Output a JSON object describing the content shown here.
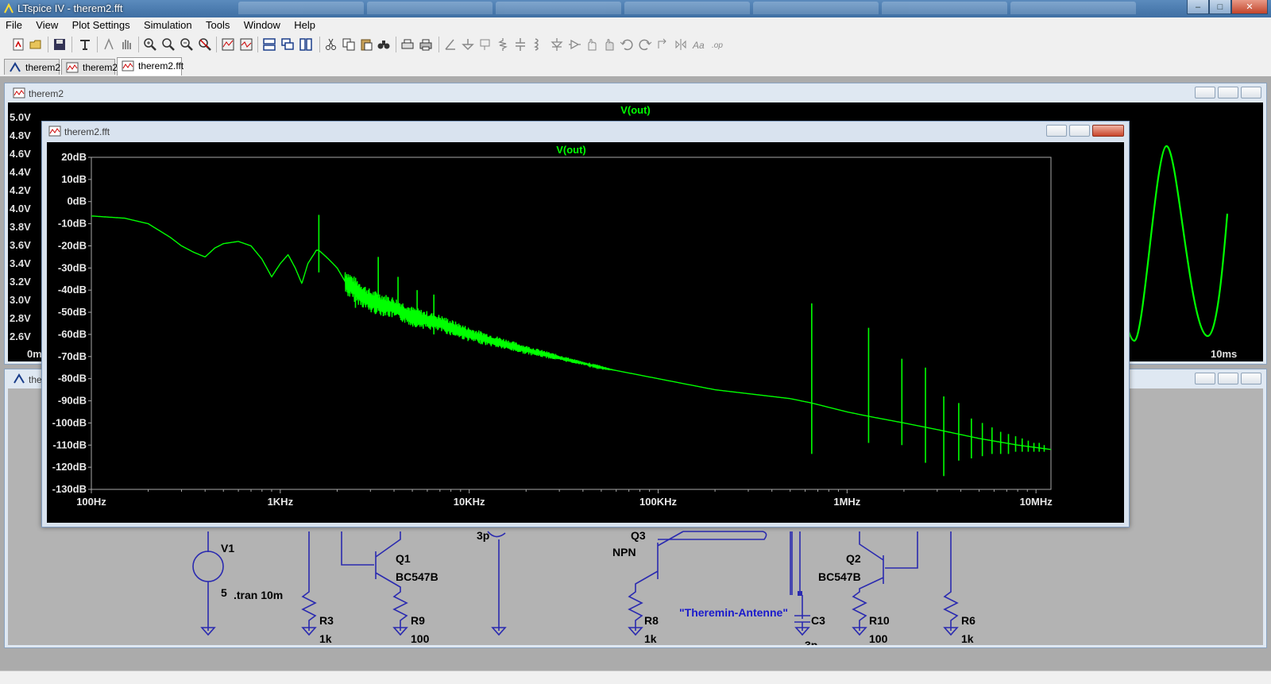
{
  "app": {
    "title": "LTspice IV - therem2.fft",
    "window_buttons": {
      "minimize": "‒",
      "maximize": "□",
      "close": "✕"
    }
  },
  "menu": {
    "items": [
      {
        "label": "File"
      },
      {
        "label": "View"
      },
      {
        "label": "Plot Settings"
      },
      {
        "label": "Simulation"
      },
      {
        "label": "Tools"
      },
      {
        "label": "Window"
      },
      {
        "label": "Help"
      }
    ]
  },
  "toolbar": {
    "buttons": [
      "new-schematic-icon",
      "open-icon",
      "save-icon",
      "control-panel-icon",
      "run-icon",
      "halt-icon",
      "zoom-in-icon",
      "zoom-out-icon",
      "zoom-fit-icon",
      "zoom-cancel-icon",
      "autorange-icon",
      "plot-icon",
      "tile-horizontal-icon",
      "cascade-icon",
      "tile-vertical-icon",
      "cut-icon",
      "copy-icon",
      "paste-icon",
      "find-icon",
      "print-setup-icon",
      "print-icon",
      "wire-icon",
      "ground-icon",
      "label-icon",
      "resistor-icon",
      "capacitor-icon",
      "inductor-icon",
      "diode-icon",
      "component-icon",
      "move-icon",
      "drag-icon",
      "undo-icon",
      "redo-icon",
      "rotate-icon",
      "mirror-icon",
      "text-icon",
      "spice-directive-icon"
    ]
  },
  "doc_tabs": [
    {
      "label": "therem2",
      "icon": "schematic-icon"
    },
    {
      "label": "therem2",
      "icon": "waveform-icon"
    },
    {
      "label": "therem2.fft",
      "icon": "waveform-icon",
      "active": true
    }
  ],
  "transient_window": {
    "title": "therem2",
    "trace": "V(out)",
    "y_ticks": [
      "5.0V",
      "4.8V",
      "4.6V",
      "4.4V",
      "4.2V",
      "4.0V",
      "3.8V",
      "3.6V",
      "3.4V",
      "3.2V",
      "3.0V",
      "2.8V",
      "2.6V"
    ],
    "x_start_partial": "0m",
    "x_mid_partial": "s",
    "x_end": "10ms",
    "trace_color": "#00ff00"
  },
  "schematic_window": {
    "title_partial": "ther",
    "labels": {
      "v1_name": "V1",
      "v1_value": "5",
      "tran": ".tran 10m",
      "q1_name": "Q1",
      "q1_model": "BC547B",
      "q3_name_partial": "Q3",
      "q3_model": "NPN",
      "q2_name": "Q2",
      "q2_model": "BC547B",
      "r3_name": "R3",
      "r3_value": "1k",
      "r9_name": "R9",
      "r9_value": "100",
      "r8_name": "R8",
      "r8_value": "1k",
      "r10_name": "R10",
      "r10_value": "100",
      "r6_name": "R6",
      "r6_value": "1k",
      "c3_name": "C3",
      "c3_value": "3p",
      "c_partial": "3p",
      "antenna_label": "\"Theremin-Antenne\""
    },
    "wire_color": "#2a2ab0",
    "text_color": "#000000",
    "antenna_color": "#1a1acc"
  },
  "fft_window": {
    "title": "therem2.fft",
    "trace": "V(out)",
    "trace_color": "#00ff00",
    "axis_color": "#b0b0b0"
  },
  "chart_data": {
    "type": "line",
    "title": "V(out)",
    "xlabel": "",
    "ylabel": "",
    "x_scale": "log",
    "x_range": [
      100,
      12000000
    ],
    "y_range": [
      -130,
      20
    ],
    "x_tick_labels": [
      "100Hz",
      "1KHz",
      "10KHz",
      "100KHz",
      "1MHz",
      "10MHz"
    ],
    "y_tick_labels": [
      "20dB",
      "10dB",
      "0dB",
      "-10dB",
      "-20dB",
      "-30dB",
      "-40dB",
      "-50dB",
      "-60dB",
      "-70dB",
      "-80dB",
      "-90dB",
      "-100dB",
      "-110dB",
      "-120dB",
      "-130dB"
    ],
    "grid": false,
    "series": [
      {
        "name": "V(out)",
        "x": [
          100,
          150,
          200,
          260,
          300,
          350,
          400,
          450,
          500,
          600,
          700,
          800,
          900,
          1000,
          1100,
          1200,
          1300,
          1400,
          1500,
          1550,
          1600,
          1700,
          1800,
          1900,
          2000,
          2200,
          2500,
          3000,
          4000,
          5000,
          7000,
          10000,
          20000,
          50000,
          100000,
          200000,
          500000,
          650000,
          1000000,
          1300000,
          2000000,
          3000000,
          5000000,
          8000000,
          12000000
        ],
        "y": [
          -6.5,
          -7.5,
          -10,
          -16,
          -20,
          -23,
          -25,
          -21,
          -19,
          -18,
          -20,
          -26,
          -34,
          -28,
          -24,
          -30,
          -37,
          -28,
          -24,
          -22,
          -22,
          -24,
          -26,
          -28,
          -30,
          -36,
          -40,
          -45,
          -48,
          -52,
          -55,
          -60,
          -67,
          -75,
          -80,
          -85,
          -89,
          -91,
          -95,
          -97,
          -100,
          -103,
          -107,
          -110,
          -112
        ]
      }
    ],
    "spikes": [
      {
        "x": 1600,
        "top": -6,
        "bottom": -32
      },
      {
        "x": 2500,
        "top": -36,
        "bottom": -48
      },
      {
        "x": 3300,
        "top": -25,
        "bottom": -43
      },
      {
        "x": 4200,
        "top": -34,
        "bottom": -50
      },
      {
        "x": 5300,
        "top": -40,
        "bottom": -56
      },
      {
        "x": 6500,
        "top": -42,
        "bottom": -60
      },
      {
        "x": 650000,
        "top": -46,
        "bottom": -114
      },
      {
        "x": 1300000,
        "top": -57,
        "bottom": -109
      },
      {
        "x": 1950000,
        "top": -71,
        "bottom": -110
      },
      {
        "x": 2600000,
        "top": -75,
        "bottom": -118
      },
      {
        "x": 3250000,
        "top": -88,
        "bottom": -124
      },
      {
        "x": 3900000,
        "top": -91,
        "bottom": -117
      },
      {
        "x": 4550000,
        "top": -98,
        "bottom": -116
      },
      {
        "x": 5200000,
        "top": -100,
        "bottom": -115
      },
      {
        "x": 5850000,
        "top": -102,
        "bottom": -114
      },
      {
        "x": 6500000,
        "top": -104,
        "bottom": -114
      },
      {
        "x": 7150000,
        "top": -105,
        "bottom": -114
      },
      {
        "x": 7800000,
        "top": -106,
        "bottom": -113
      },
      {
        "x": 8450000,
        "top": -107,
        "bottom": -113
      },
      {
        "x": 9100000,
        "top": -108,
        "bottom": -113
      },
      {
        "x": 9750000,
        "top": -109,
        "bottom": -113
      },
      {
        "x": 10400000,
        "top": -109,
        "bottom": -113
      },
      {
        "x": 11050000,
        "top": -110,
        "bottom": -113
      }
    ]
  }
}
